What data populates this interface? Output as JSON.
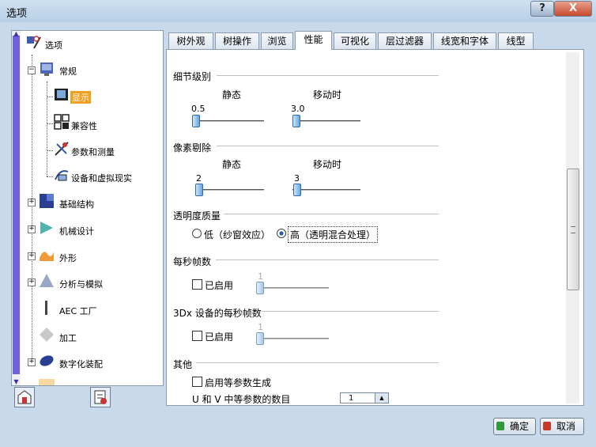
{
  "window": {
    "title": "选项",
    "help_label": "?",
    "close_label": "X"
  },
  "tree": {
    "items": [
      {
        "label": "选项"
      },
      {
        "label": "常规"
      },
      {
        "label": "显示"
      },
      {
        "label": "兼容性"
      },
      {
        "label": "参数和测量"
      },
      {
        "label": "设备和虚拟现实"
      },
      {
        "label": "基础结构"
      },
      {
        "label": "机械设计"
      },
      {
        "label": "外形"
      },
      {
        "label": "分析与模拟"
      },
      {
        "label": "AEC 工厂"
      },
      {
        "label": "加工"
      },
      {
        "label": "数字化装配"
      }
    ]
  },
  "tabs": [
    "树外观",
    "树操作",
    "浏览",
    "性能",
    "可视化",
    "层过滤器",
    "线宽和字体",
    "线型"
  ],
  "active_tab": "性能",
  "sections": {
    "detail": {
      "title": "细节级别",
      "static_label": "静态",
      "moving_label": "移动时",
      "static_value": "0.5",
      "moving_value": "3.0"
    },
    "pixel": {
      "title": "像素剔除",
      "static_label": "静态",
      "moving_label": "移动时",
      "static_value": "2",
      "moving_value": "3"
    },
    "transparency": {
      "title": "透明度质量",
      "low_label": "低（纱窗效应）",
      "high_label": "高（透明混合处理）",
      "selected": "高（透明混合处理）"
    },
    "fps": {
      "title": "每秒帧数",
      "enabled_label": "已启用",
      "value": "1"
    },
    "fps3dx": {
      "title": "3Dx 设备的每秒帧数",
      "enabled_label": "已启用",
      "value": "1"
    },
    "other": {
      "title": "其他",
      "isoparam_label": "启用等参数生成",
      "uv_label": "U 和 V 中等参数的数目",
      "uv_value": "1"
    }
  },
  "buttons": {
    "ok": "确定",
    "cancel": "取消"
  },
  "colors": {
    "accent": "#f0a020",
    "tree_scroll": "#6f62d6",
    "window_bg": "#c7d9ea"
  }
}
